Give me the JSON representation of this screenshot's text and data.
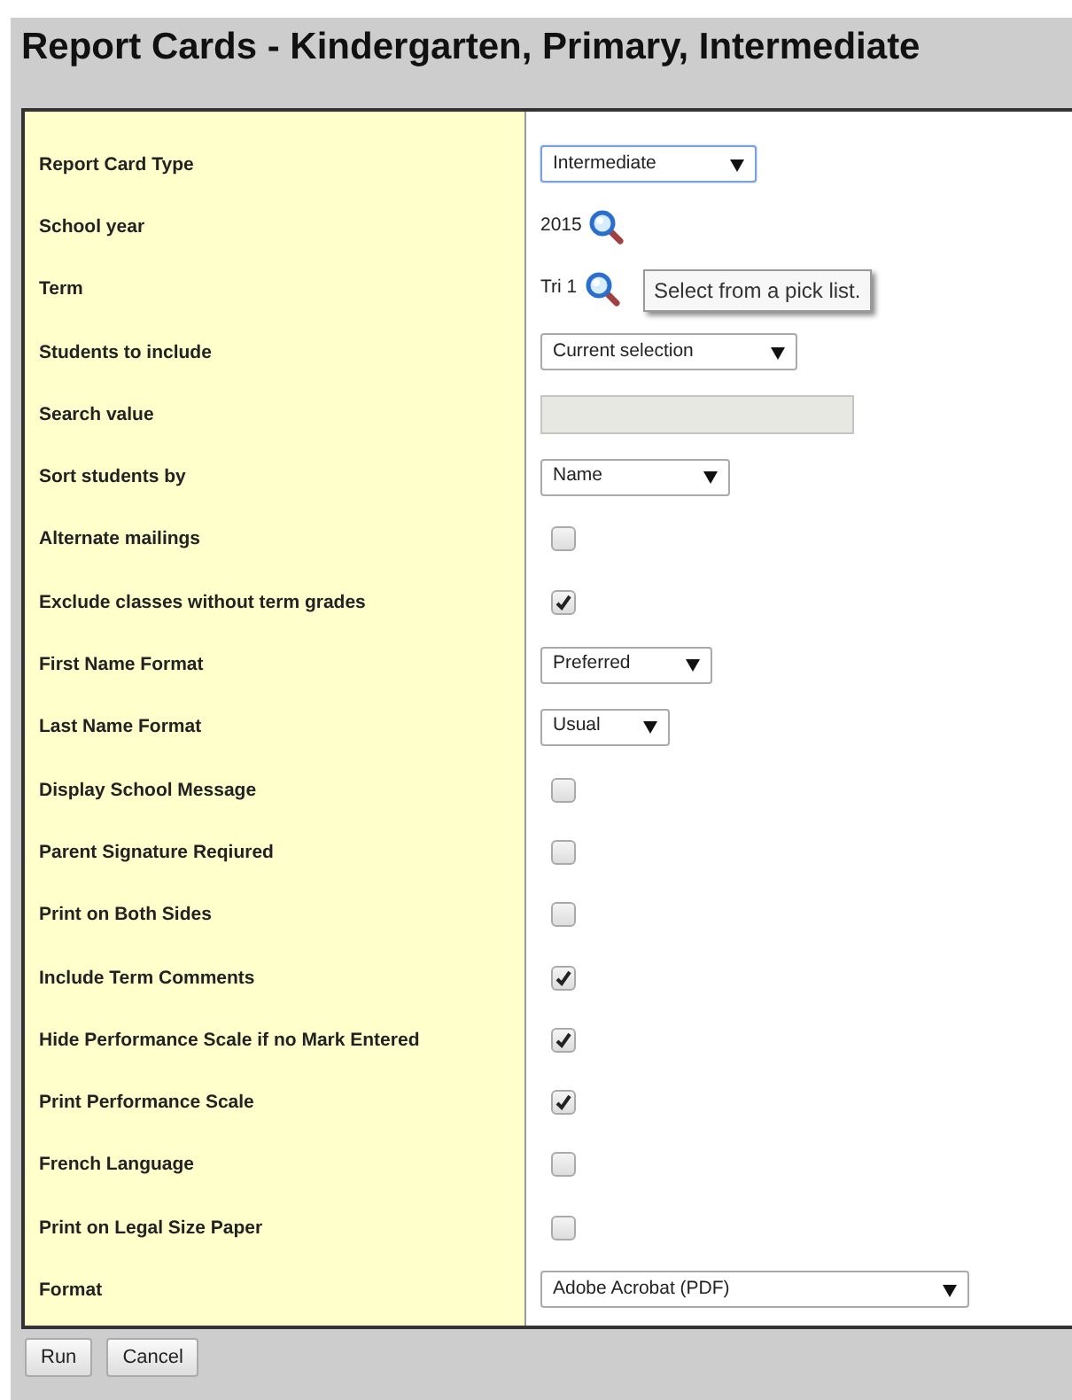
{
  "title": "Report Cards - Kindergarten, Primary, Intermediate",
  "fields": [
    {
      "label": "Report Card Type",
      "kind": "select",
      "value": "Intermediate"
    },
    {
      "label": "School year",
      "kind": "lookup",
      "value": "2015"
    },
    {
      "label": "Term",
      "kind": "lookup",
      "value": "Tri 1",
      "tooltip": "Select from a pick list."
    },
    {
      "label": "Students to include",
      "kind": "select",
      "value": "Current selection"
    },
    {
      "label": "Search value",
      "kind": "text",
      "disabled": true
    },
    {
      "label": "Sort students by",
      "kind": "select",
      "value": "Name"
    },
    {
      "label": "Alternate mailings",
      "kind": "checkbox",
      "checked": false
    },
    {
      "label": "Exclude classes without term grades",
      "kind": "checkbox",
      "checked": true
    },
    {
      "label": "First Name Format",
      "kind": "select",
      "value": "Preferred"
    },
    {
      "label": "Last Name Format",
      "kind": "select",
      "value": "Usual"
    },
    {
      "label": "Display School Message",
      "kind": "checkbox",
      "checked": false
    },
    {
      "label": "Parent Signature Reqiured",
      "kind": "checkbox",
      "checked": false
    },
    {
      "label": "Print on Both Sides",
      "kind": "checkbox",
      "checked": false
    },
    {
      "label": "Include Term Comments",
      "kind": "checkbox",
      "checked": true
    },
    {
      "label": "Hide Performance Scale if no Mark Entered",
      "kind": "checkbox",
      "checked": true
    },
    {
      "label": "Print Performance Scale",
      "kind": "checkbox",
      "checked": true
    },
    {
      "label": "French Language",
      "kind": "checkbox",
      "checked": false
    },
    {
      "label": "Print on Legal Size Paper",
      "kind": "checkbox",
      "checked": false
    },
    {
      "label": "Format",
      "kind": "select",
      "value": "Adobe Acrobat (PDF)"
    }
  ],
  "buttons": [
    "Run",
    "Cancel"
  ]
}
